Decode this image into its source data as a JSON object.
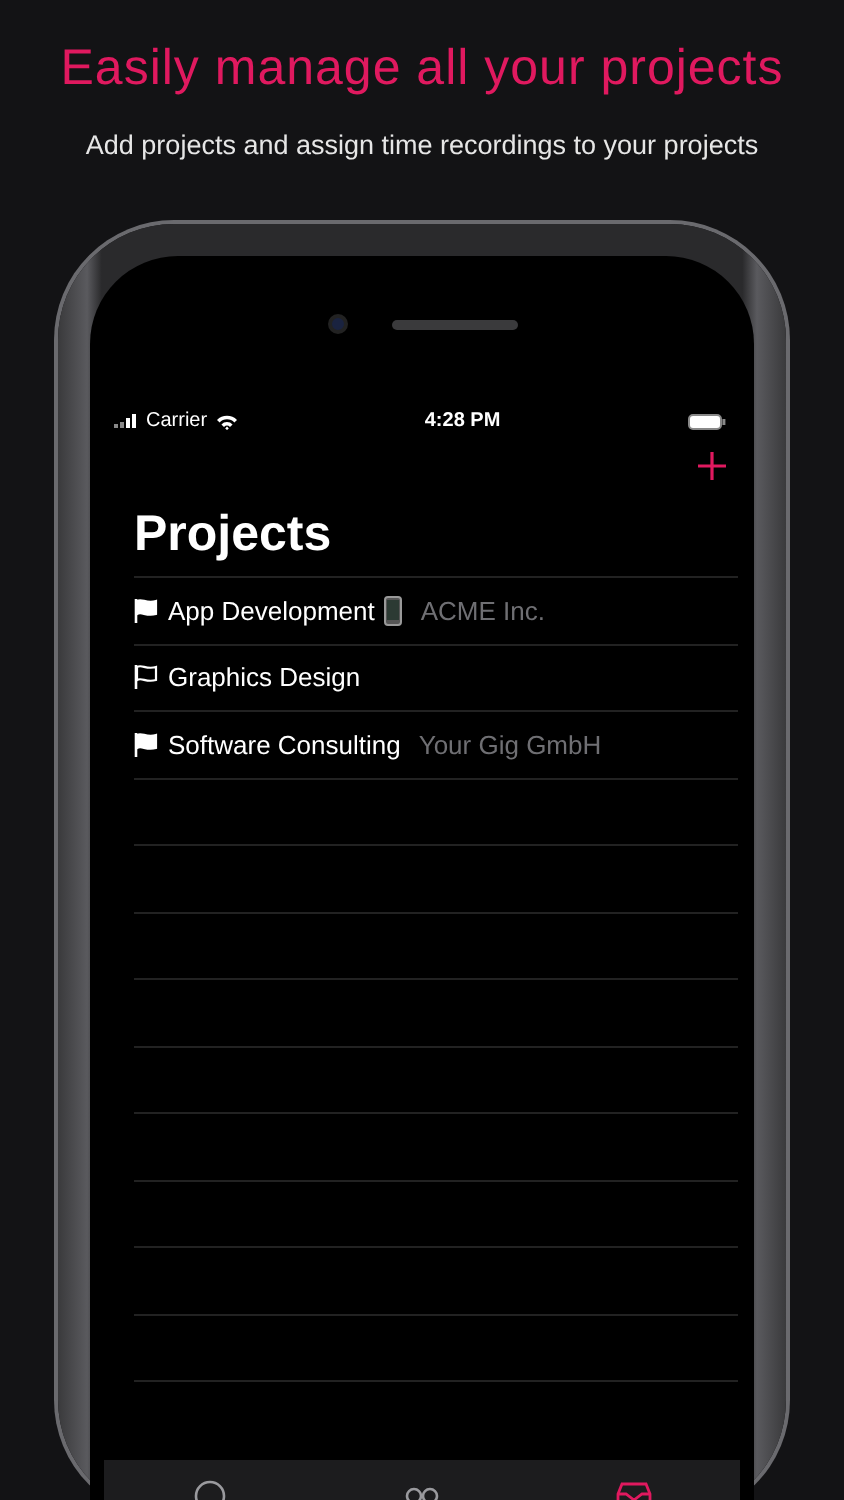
{
  "headline": "Easily manage all your projects",
  "subtitle": "Add projects and assign time recordings to your projects",
  "status_bar": {
    "carrier": "Carrier",
    "time": "4:28 PM"
  },
  "title": "Projects",
  "projects": [
    {
      "name": "App Development",
      "device_icon": true,
      "client": "ACME Inc.",
      "flag_filled": true
    },
    {
      "name": "Graphics Design",
      "device_icon": false,
      "flag_filled": false
    },
    {
      "name": "Software Consulting",
      "device_icon": false,
      "client": "Your Gig GmbH",
      "flag_filled": true
    }
  ],
  "tab_bar": [
    {
      "kind": "circle",
      "selected": false
    },
    {
      "kind": "voicemail",
      "selected": false
    },
    {
      "kind": "archive",
      "selected": true
    }
  ]
}
